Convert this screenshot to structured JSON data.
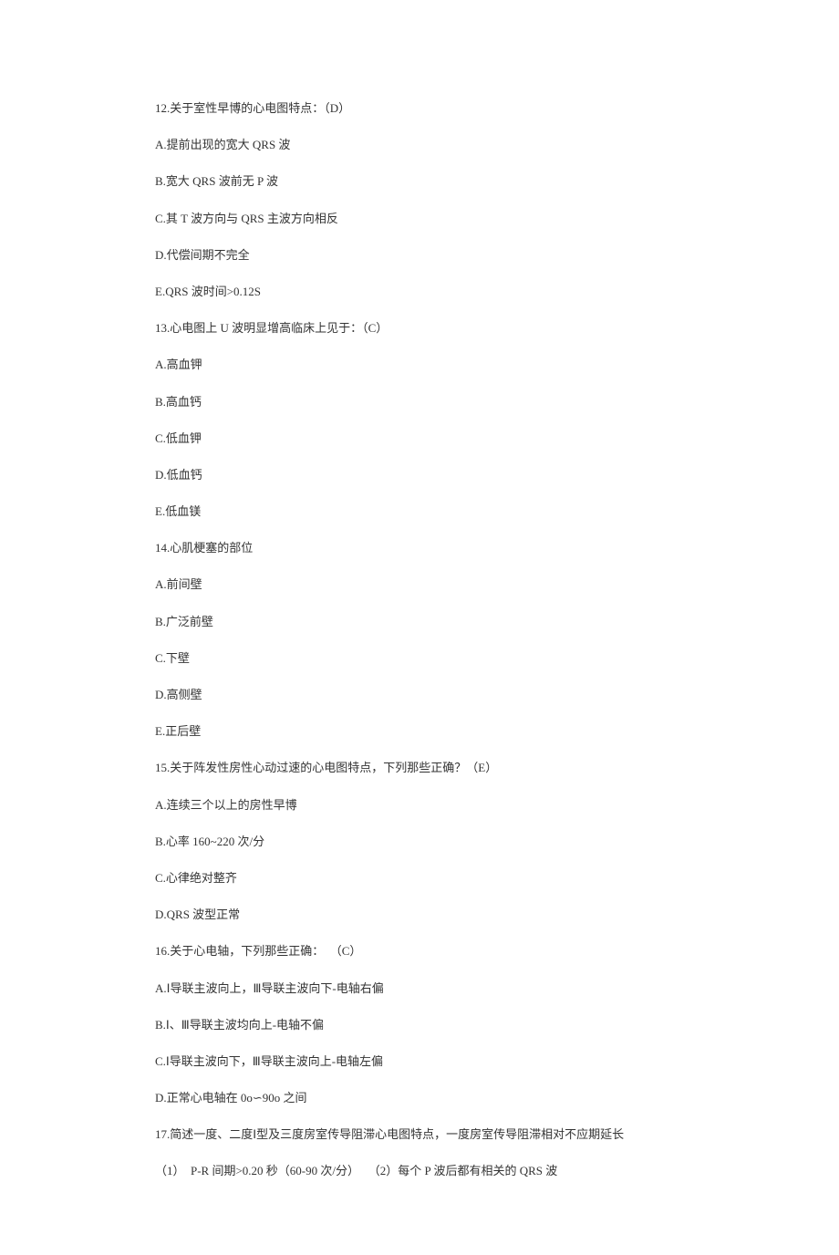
{
  "questions": [
    {
      "stem": "12.关于室性早博的心电图特点：（D）",
      "options": [
        "A.提前出现的宽大 QRS 波",
        "B.宽大 QRS 波前无 P 波",
        "C.其 T 波方向与 QRS 主波方向相反",
        "D.代偿间期不完全",
        "E.QRS 波时间>0.12S"
      ]
    },
    {
      "stem": "13.心电图上 U 波明显增高临床上见于：（C）",
      "options": [
        "A.高血钾",
        "B.高血钙",
        "C.低血钾",
        "D.低血钙",
        "E.低血镁"
      ]
    },
    {
      "stem": "14.心肌梗塞的部位",
      "options": [
        "A.前间壁",
        "B.广泛前壁",
        "C.下壁",
        "D.高侧壁",
        "E.正后壁"
      ]
    },
    {
      "stem": "15.关于阵发性房性心动过速的心电图特点，下列那些正确？（E）",
      "options": [
        "A.连续三个以上的房性早博",
        "B.心率 160~220 次/分",
        "C.心律绝对整齐",
        "D.QRS 波型正常"
      ]
    },
    {
      "stem": "16.关于心电轴，下列那些正确：  （C）",
      "options": [
        "A.Ⅰ导联主波向上，Ⅲ导联主波向下-电轴右偏",
        "B.Ⅰ、Ⅲ导联主波均向上-电轴不偏",
        "C.Ⅰ导联主波向下，Ⅲ导联主波向上-电轴左偏",
        "D.正常心电轴在 0o∽90o 之间"
      ]
    },
    {
      "stem": "17.简述一度、二度Ⅰ型及三度房室传导阻滞心电图特点，一度房室传导阻滞相对不应期延长",
      "options": [
        "（1）  P-R 间期>0.20 秒（60-90 次/分）   （2）每个 P 波后都有相关的 QRS 波"
      ]
    }
  ]
}
